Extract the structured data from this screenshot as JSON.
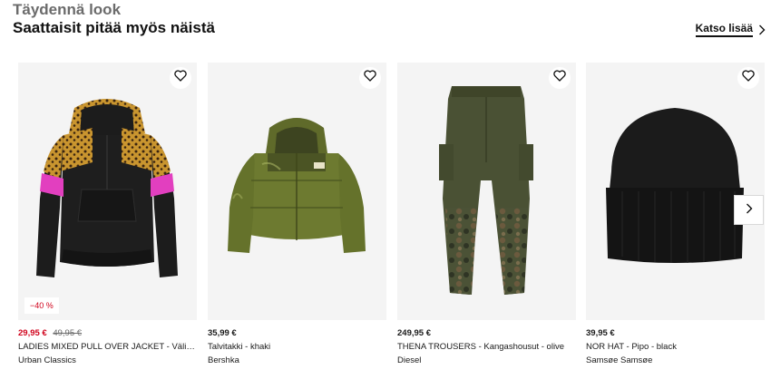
{
  "section": {
    "kicker": "Täydennä look",
    "title": "Saattaisit pitää myös näistä",
    "see_more": "Katso lisää",
    "chevron_icon": "chevron-right-icon",
    "next_icon": "chevron-right-icon",
    "wishlist_icon": "heart-icon"
  },
  "products": [
    {
      "price": "29,95 €",
      "original_price": "49,95 €",
      "discount": "−40 %",
      "name": "LADIES MIXED PULL OVER JACKET - Välikausitakki",
      "brand": "Urban Classics"
    },
    {
      "price": "35,99 €",
      "original_price": "",
      "discount": "",
      "name": "Talvitakki - khaki",
      "brand": "Bershka"
    },
    {
      "price": "249,95 €",
      "original_price": "",
      "discount": "",
      "name": "THENA TROUSERS - Kangashousut - olive",
      "brand": "Diesel"
    },
    {
      "price": "39,95 €",
      "original_price": "",
      "discount": "",
      "name": "NOR HAT - Pipo - black",
      "brand": "Samsøe Samsøe"
    }
  ],
  "colors": {
    "sale": "#d0021b",
    "image_bg": "#f4f4f4",
    "text": "#1a1a1a"
  }
}
